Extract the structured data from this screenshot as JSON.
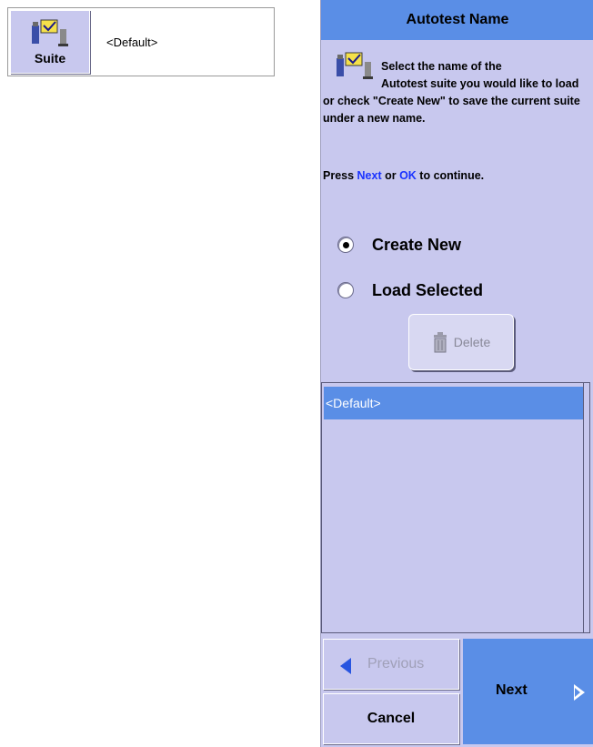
{
  "suite_widget": {
    "button_label": "Suite",
    "value": "<Default>",
    "icon": "autotest-suite-icon"
  },
  "dialog": {
    "title": "Autotest Name",
    "instruction_line1": "Select the name of the",
    "instruction_rest": "Autotest suite you would like to load or check \"Create New\" to save the current suite under a new name.",
    "press_prefix": "Press ",
    "press_next": "Next",
    "press_or": " or ",
    "press_ok": "OK",
    "press_suffix": " to continue.",
    "options": {
      "create_new": "Create New",
      "load_selected": "Load Selected",
      "selected": "create_new"
    },
    "delete_label": "Delete",
    "list_items": [
      "<Default>"
    ],
    "previous_label": "Previous",
    "cancel_label": "Cancel",
    "next_label": "Next"
  },
  "colors": {
    "panel": "#c8c8ee",
    "accent": "#5a8ee6",
    "link_blue": "#1a33ff"
  }
}
